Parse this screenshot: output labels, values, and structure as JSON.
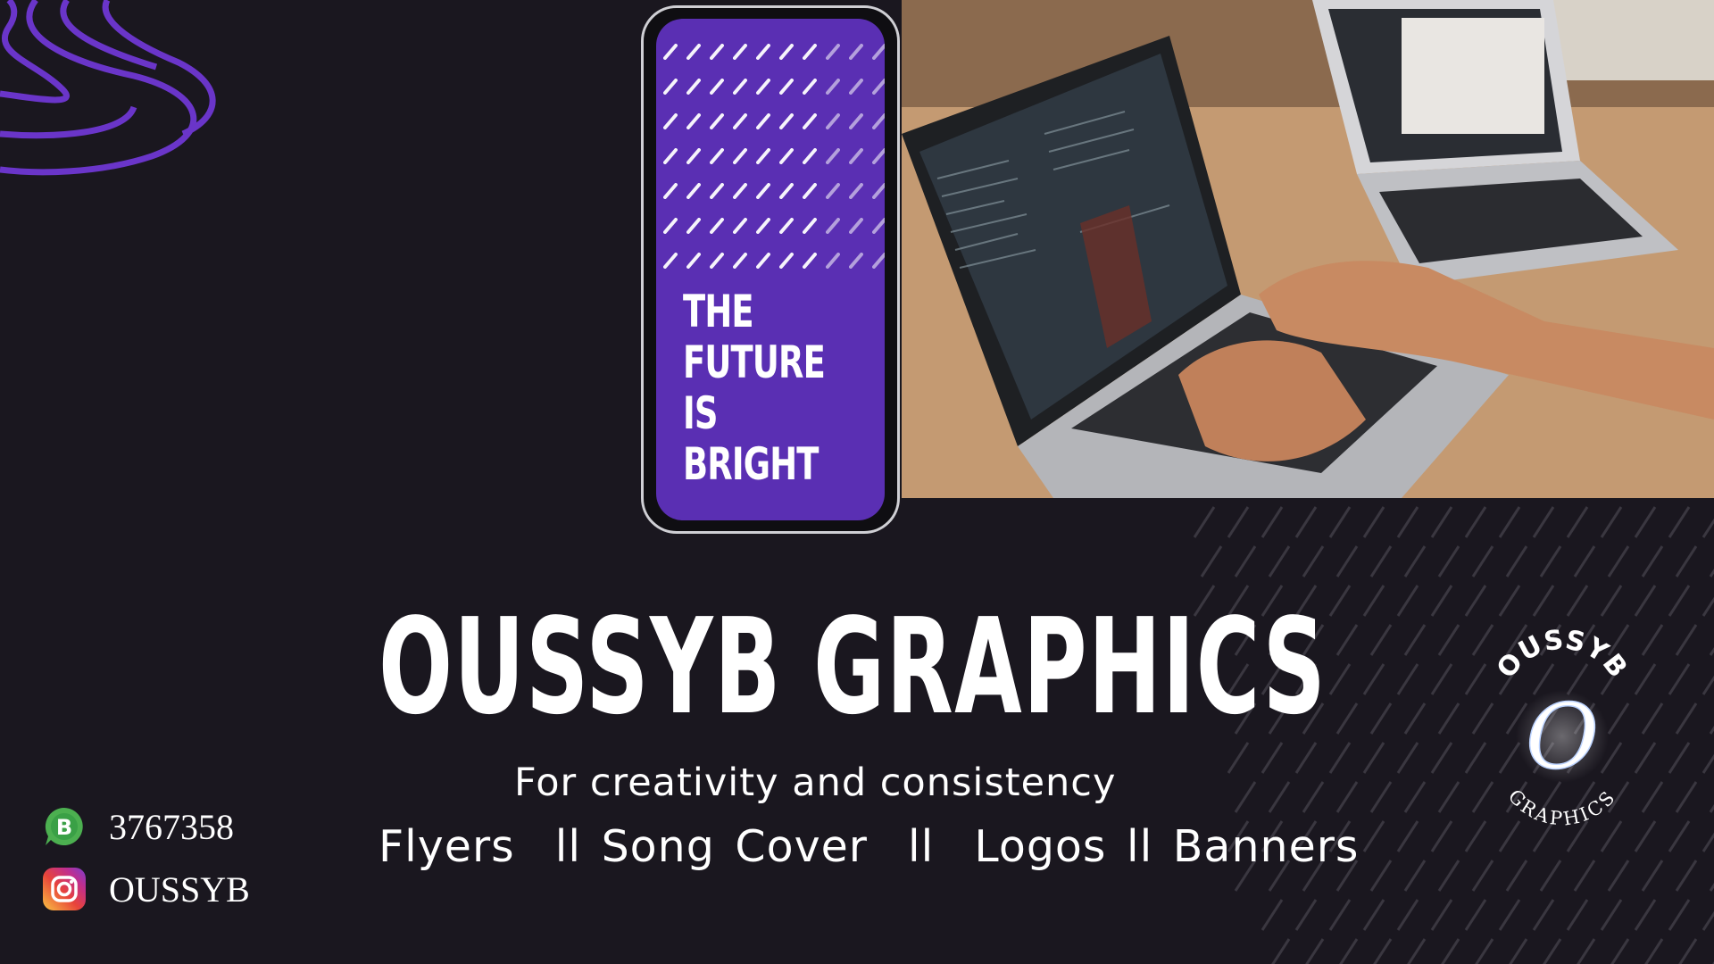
{
  "phone": {
    "line1": "THE",
    "line2": "FUTURE",
    "line3": "IS",
    "line4": "BRIGHT"
  },
  "brand": {
    "title": "OUSSYB GRAPHICS",
    "tagline": "For creativity and consistency",
    "services": "Flyers  ll Song Cover  ll  Logos ll Banners"
  },
  "contact": {
    "phone": "3767358",
    "instagram": "OUSSYB"
  },
  "logo": {
    "top_text": "OUSSYB",
    "letter": "O",
    "bottom_text": "GRAPHICS"
  },
  "colors": {
    "background": "#1a171f",
    "accent_purple": "#5a2fb3",
    "swirl_purple": "#6a35c9"
  },
  "icons": {
    "contact_phone": "whatsapp-business-icon",
    "contact_social": "instagram-icon"
  }
}
